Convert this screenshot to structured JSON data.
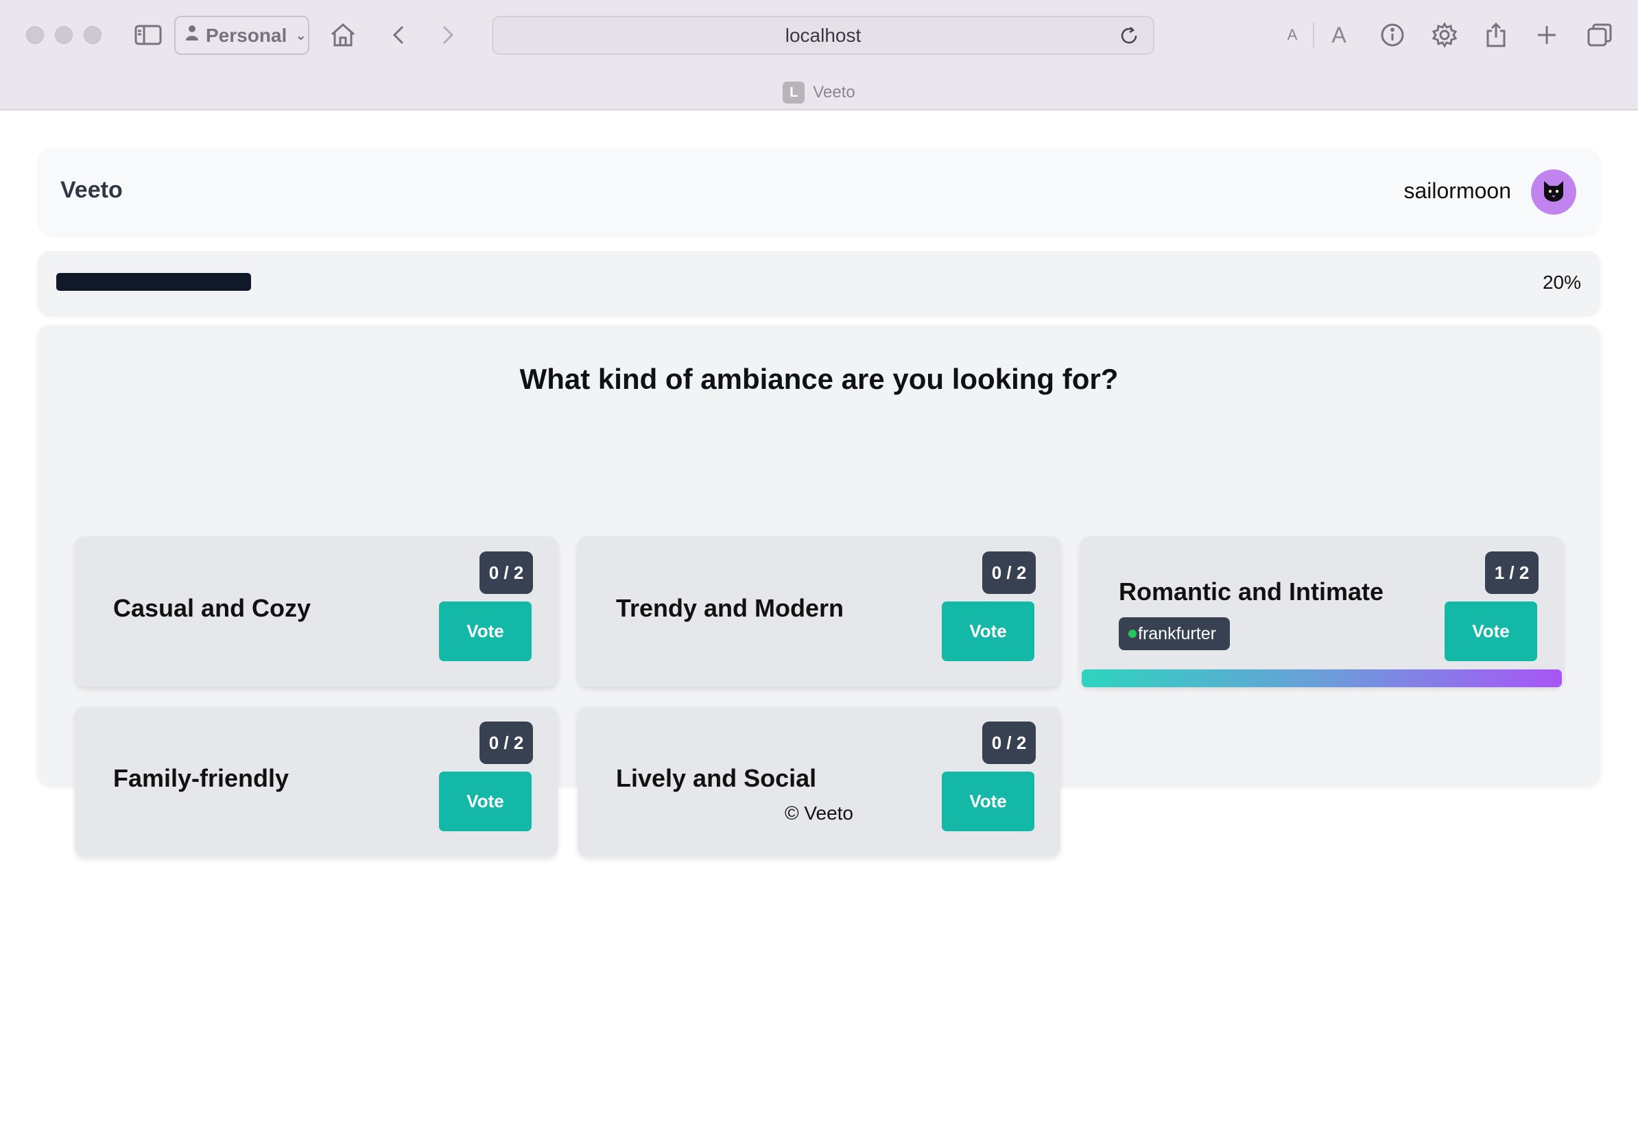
{
  "browser": {
    "profile_label": "Personal",
    "url": "localhost",
    "tab_favicon_letter": "L",
    "tab_title": "Veeto"
  },
  "navbar": {
    "brand": "Veeto",
    "username": "sailormoon",
    "avatar_color": "#c184ee"
  },
  "progress": {
    "percent": 20,
    "label": "20%"
  },
  "question": "What kind of ambiance are you looking for?",
  "options": [
    {
      "title": "Casual and Cozy",
      "count": "0 / 2",
      "vote_label": "Vote",
      "voters": [],
      "vote_fraction": 0
    },
    {
      "title": "Trendy and Modern",
      "count": "0 / 2",
      "vote_label": "Vote",
      "voters": [],
      "vote_fraction": 0
    },
    {
      "title": "Romantic and Intimate",
      "count": "1 / 2",
      "vote_label": "Vote",
      "voters": [
        "frankfurter"
      ],
      "vote_fraction": 1
    },
    {
      "title": "Family-friendly",
      "count": "0 / 2",
      "vote_label": "Vote",
      "voters": [],
      "vote_fraction": 0
    },
    {
      "title": "Lively and Social",
      "count": "0 / 2",
      "vote_label": "Vote",
      "voters": [],
      "vote_fraction": 0
    }
  ],
  "footer": "© Veeto",
  "colors": {
    "accent": "#14b8a6",
    "badge": "#374151",
    "progress_fill": "#111827",
    "online_dot": "#22c55e"
  }
}
